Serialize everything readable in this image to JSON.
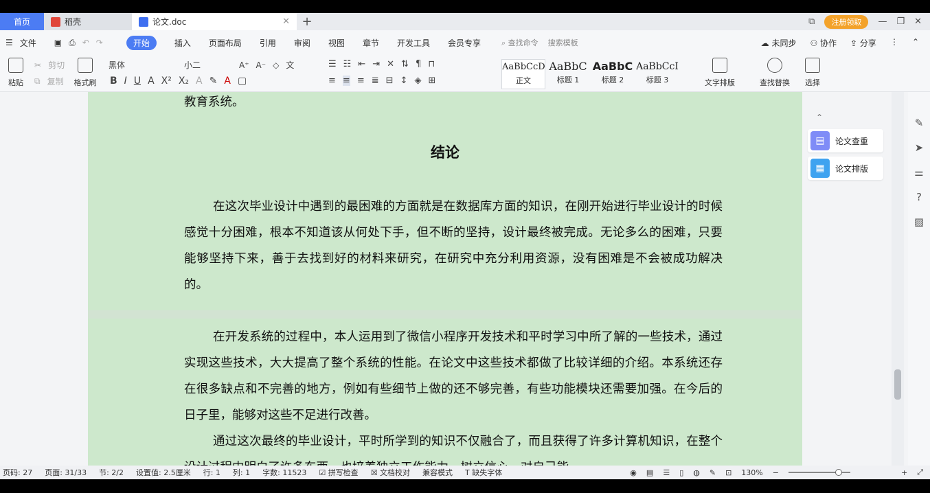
{
  "tabs": {
    "home": "首页",
    "tab1": "稻壳",
    "tab2": "论文.doc",
    "vip": "注册领取"
  },
  "menu": {
    "file": "文件",
    "items": [
      "开始",
      "插入",
      "页面布局",
      "引用",
      "审阅",
      "视图",
      "章节",
      "开发工具",
      "会员专享"
    ],
    "search_cmd": "查找命令",
    "search_tpl": "搜索模板",
    "sync": "未同步",
    "collab": "协作",
    "share": "分享"
  },
  "ribbon": {
    "paste": "粘贴",
    "cut": "剪切",
    "copy": "复制",
    "format_painter": "格式刷",
    "font": "黑体",
    "size": "小二",
    "styles": [
      {
        "sample": "AaBbCcDd",
        "name": "正文"
      },
      {
        "sample": "AaBbC",
        "name": "标题 1"
      },
      {
        "sample": "AaBbC",
        "name": "标题 2"
      },
      {
        "sample": "AaBbCcI",
        "name": "标题 3"
      }
    ],
    "text_layout": "文字排版",
    "find_replace": "查找替换",
    "select": "选择"
  },
  "document": {
    "prev_tail": "教育系统。",
    "heading": "结论",
    "para1": "在这次毕业设计中遇到的最困难的方面就是在数据库方面的知识，在刚开始进行毕业设计的时候感觉十分困难，根本不知道该从何处下手，但不断的坚持，设计最终被完成。无论多么的困难，只要能够坚持下来，善于去找到好的材料来研究，在研究中充分利用资源，没有困难是不会被成功解决的。",
    "para2": "在开发系统的过程中，本人运用到了微信小程序开发技术和平时学习中所了解的一些技术，通过实现这些技术，大大提高了整个系统的性能。在论文中这些技术都做了比较详细的介绍。本系统还存在很多缺点和不完善的地方，例如有些细节上做的还不够完善，有些功能模块还需要加强。在今后的日子里，能够对这些不足进行改善。",
    "para3": "通过这次最终的毕业设计，平时所学到的知识不仅融合了，而且获得了许多计算机知识，在整个设计过程中明白了许多东西，也培养独立工作能力，树立信心，对自己能"
  },
  "side": {
    "check": "论文查重",
    "layout": "论文排版"
  },
  "status": {
    "page_no": "页码: 27",
    "pages": "页面: 31/33",
    "section": "节: 2/2",
    "setting": "设置值: 2.5厘米",
    "row": "行: 1",
    "col": "列: 1",
    "words": "字数: 11523",
    "spell": "拼写检查",
    "proof": "文档校对",
    "compat": "兼容模式",
    "missing_font": "缺失字体",
    "zoom": "130%"
  }
}
